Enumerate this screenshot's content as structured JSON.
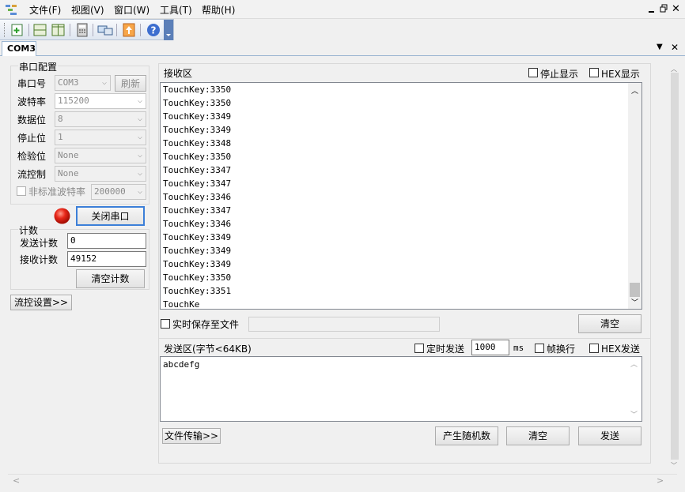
{
  "menu": {
    "items": [
      "文件(F)",
      "视图(V)",
      "窗口(W)",
      "工具(T)",
      "帮助(H)"
    ]
  },
  "tab": {
    "label": "COM3"
  },
  "serial": {
    "group_title": "串口配置",
    "port_label": "串口号",
    "port_value": "COM3",
    "refresh": "刷新",
    "baud_label": "波特率",
    "baud_value": "115200",
    "databits_label": "数据位",
    "databits_value": "8",
    "stopbits_label": "停止位",
    "stopbits_value": "1",
    "parity_label": "检验位",
    "parity_value": "None",
    "flow_label": "流控制",
    "flow_value": "None",
    "nonstd_label": "非标准波特率",
    "nonstd_value": "200000",
    "close_button": "关闭串口"
  },
  "counter": {
    "group_title": "计数",
    "send_label": "发送计数",
    "send_value": "0",
    "recv_label": "接收计数",
    "recv_value": "49152",
    "clear": "清空计数"
  },
  "flow_settings": "流控设置>>",
  "receive": {
    "title": "接收区",
    "stop_display": "停止显示",
    "hex_display": "HEX显示",
    "lines": [
      "TouchKey:3350",
      "TouchKey:3350",
      "TouchKey:3349",
      "TouchKey:3349",
      "TouchKey:3348",
      "TouchKey:3350",
      "TouchKey:3347",
      "TouchKey:3347",
      "TouchKey:3346",
      "TouchKey:3347",
      "TouchKey:3346",
      "TouchKey:3349",
      "TouchKey:3349",
      "TouchKey:3349",
      "TouchKey:3350",
      "TouchKey:3351",
      "TouchKe"
    ],
    "save_label": "实时保存至文件",
    "clear": "清空"
  },
  "send": {
    "title": "发送区(字节<64KB)",
    "timed_label": "定时发送",
    "interval_value": "1000",
    "ms": "ms",
    "newline_label": "帧换行",
    "hex_send": "HEX发送",
    "content": "abcdefg",
    "file_transfer": "文件传输>>",
    "random": "产生随机数",
    "clear": "清空",
    "send": "发送"
  }
}
